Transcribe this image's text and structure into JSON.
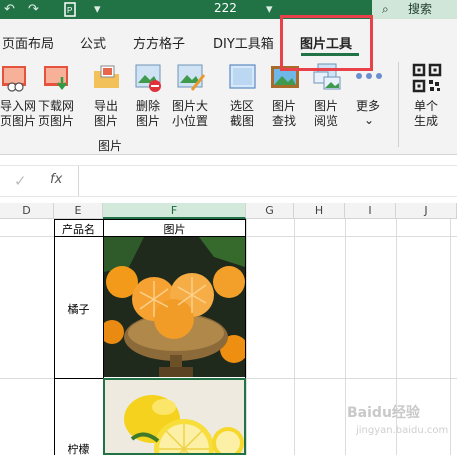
{
  "titlebar": {
    "title": "222",
    "undo_glyph": "↶",
    "redo_glyph": "↷",
    "dropdown_glyph": "▾",
    "search_label": "搜索",
    "search_glyph": "⌕"
  },
  "tabs": [
    "页面布局",
    "公式",
    "方方格子",
    "DIY工具箱",
    "图片工具"
  ],
  "active_tab": "图片工具",
  "ribbon": {
    "buttons": [
      {
        "label1": "导入网",
        "label2": "页图片"
      },
      {
        "label1": "下载网",
        "label2": "页图片"
      },
      {
        "label1": "导出",
        "label2": "图片"
      },
      {
        "label1": "删除",
        "label2": "图片"
      },
      {
        "label1": "图片大",
        "label2": "小位置"
      },
      {
        "label1": "选区",
        "label2": "截图"
      },
      {
        "label1": "图片",
        "label2": "查找"
      },
      {
        "label1": "图片",
        "label2": "阅览"
      },
      {
        "label1": "更多",
        "label2": "⌄"
      },
      {
        "label1": "单个",
        "label2": "生成"
      }
    ],
    "group_label": "图片"
  },
  "formula_bar": {
    "check_glyph": "✓",
    "fx_label": "fx",
    "value": ""
  },
  "columns": [
    "D",
    "E",
    "F",
    "G",
    "H",
    "I",
    "J"
  ],
  "selected_column": "F",
  "table": {
    "header": [
      "产品名",
      "图片"
    ],
    "rows": [
      {
        "name": "橘子",
        "image": "orange-photo"
      },
      {
        "name": "柠檬",
        "image": "lemon-photo"
      }
    ]
  },
  "watermark": {
    "text": "Baidu经验",
    "sub": "jingyan.baidu.com"
  }
}
